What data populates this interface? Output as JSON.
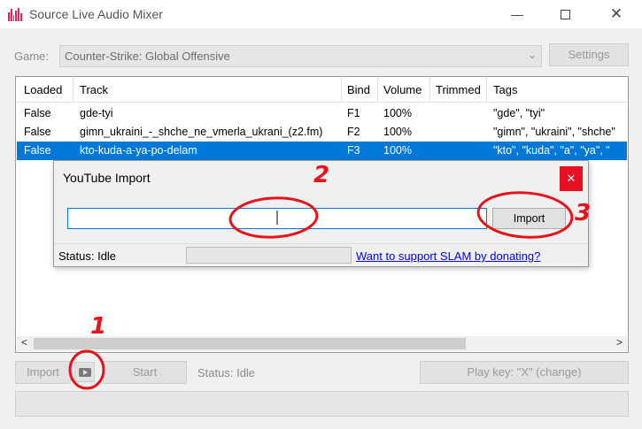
{
  "window": {
    "title": "Source Live Audio Mixer"
  },
  "game": {
    "label": "Game:",
    "value": "Counter-Strike: Global Offensive",
    "settings_label": "Settings"
  },
  "table": {
    "columns": [
      "Loaded",
      "Track",
      "Bind",
      "Volume",
      "Trimmed",
      "Tags"
    ],
    "rows": [
      {
        "loaded": "False",
        "track": "gde-tyi",
        "bind": "F1",
        "volume": "100%",
        "trimmed": "",
        "tags": "\"gde\", \"tyi\""
      },
      {
        "loaded": "False",
        "track": "gimn_ukraini_-_shche_ne_vmerla_ukrani_(z2.fm)",
        "bind": "F2",
        "volume": "100%",
        "trimmed": "",
        "tags": "\"gimn\", \"ukraini\", \"shche\""
      },
      {
        "loaded": "False",
        "track": "kto-kuda-a-ya-po-delam",
        "bind": "F3",
        "volume": "100%",
        "trimmed": "",
        "tags": "\"kto\", \"kuda\", \"a\", \"ya\", \""
      }
    ]
  },
  "bottom": {
    "import_label": "Import",
    "start_label": "Start",
    "status_text": "Status: Idle",
    "playkey_label": "Play key: \"X\" (change)"
  },
  "dialog": {
    "title": "YouTube Import",
    "url_value": "",
    "import_label": "Import",
    "status_text": "Status: Idle",
    "link_text": "Want to support SLAM by donating?"
  },
  "annotations": {
    "n1": "1",
    "n2": "2",
    "n3": "3"
  },
  "colors": {
    "selection": "#0078d7",
    "annotation": "#e8121b",
    "close": "#e81123",
    "link": "#0000ff"
  }
}
